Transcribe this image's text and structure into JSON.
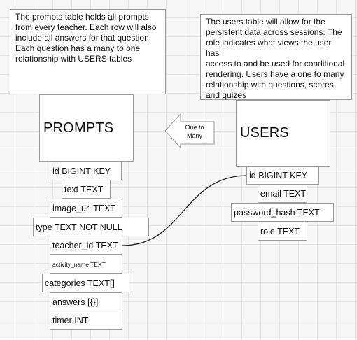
{
  "prompts": {
    "note": "The prompts table holds all prompts\nfrom every teacher. Each row will also\ninclude all answers for that question.\nEach question has a many to one\nrelationship with USERS tables",
    "title": "PROMPTS",
    "fields": [
      "id BIGINT KEY",
      "text TEXT",
      "image_url TEXT",
      "type TEXT NOT NULL",
      "teacher_id TEXT",
      "activity_name TEXT",
      "categories TEXT[]",
      "answers [{}]",
      "timer INT"
    ]
  },
  "users": {
    "note": "The users table will allow for the\npersistent data across sessions. The\nrole indicates what views the user has\naccess to and be used for conditional\nrendering. Users have a one to many\nrelationship with questions, scores,\nand quizes",
    "title": "USERS",
    "fields": [
      "id BIGINT KEY",
      "email TEXT",
      "password_hash TEXT",
      "role TEXT"
    ]
  },
  "relationship": {
    "label": "One to\nMany"
  }
}
